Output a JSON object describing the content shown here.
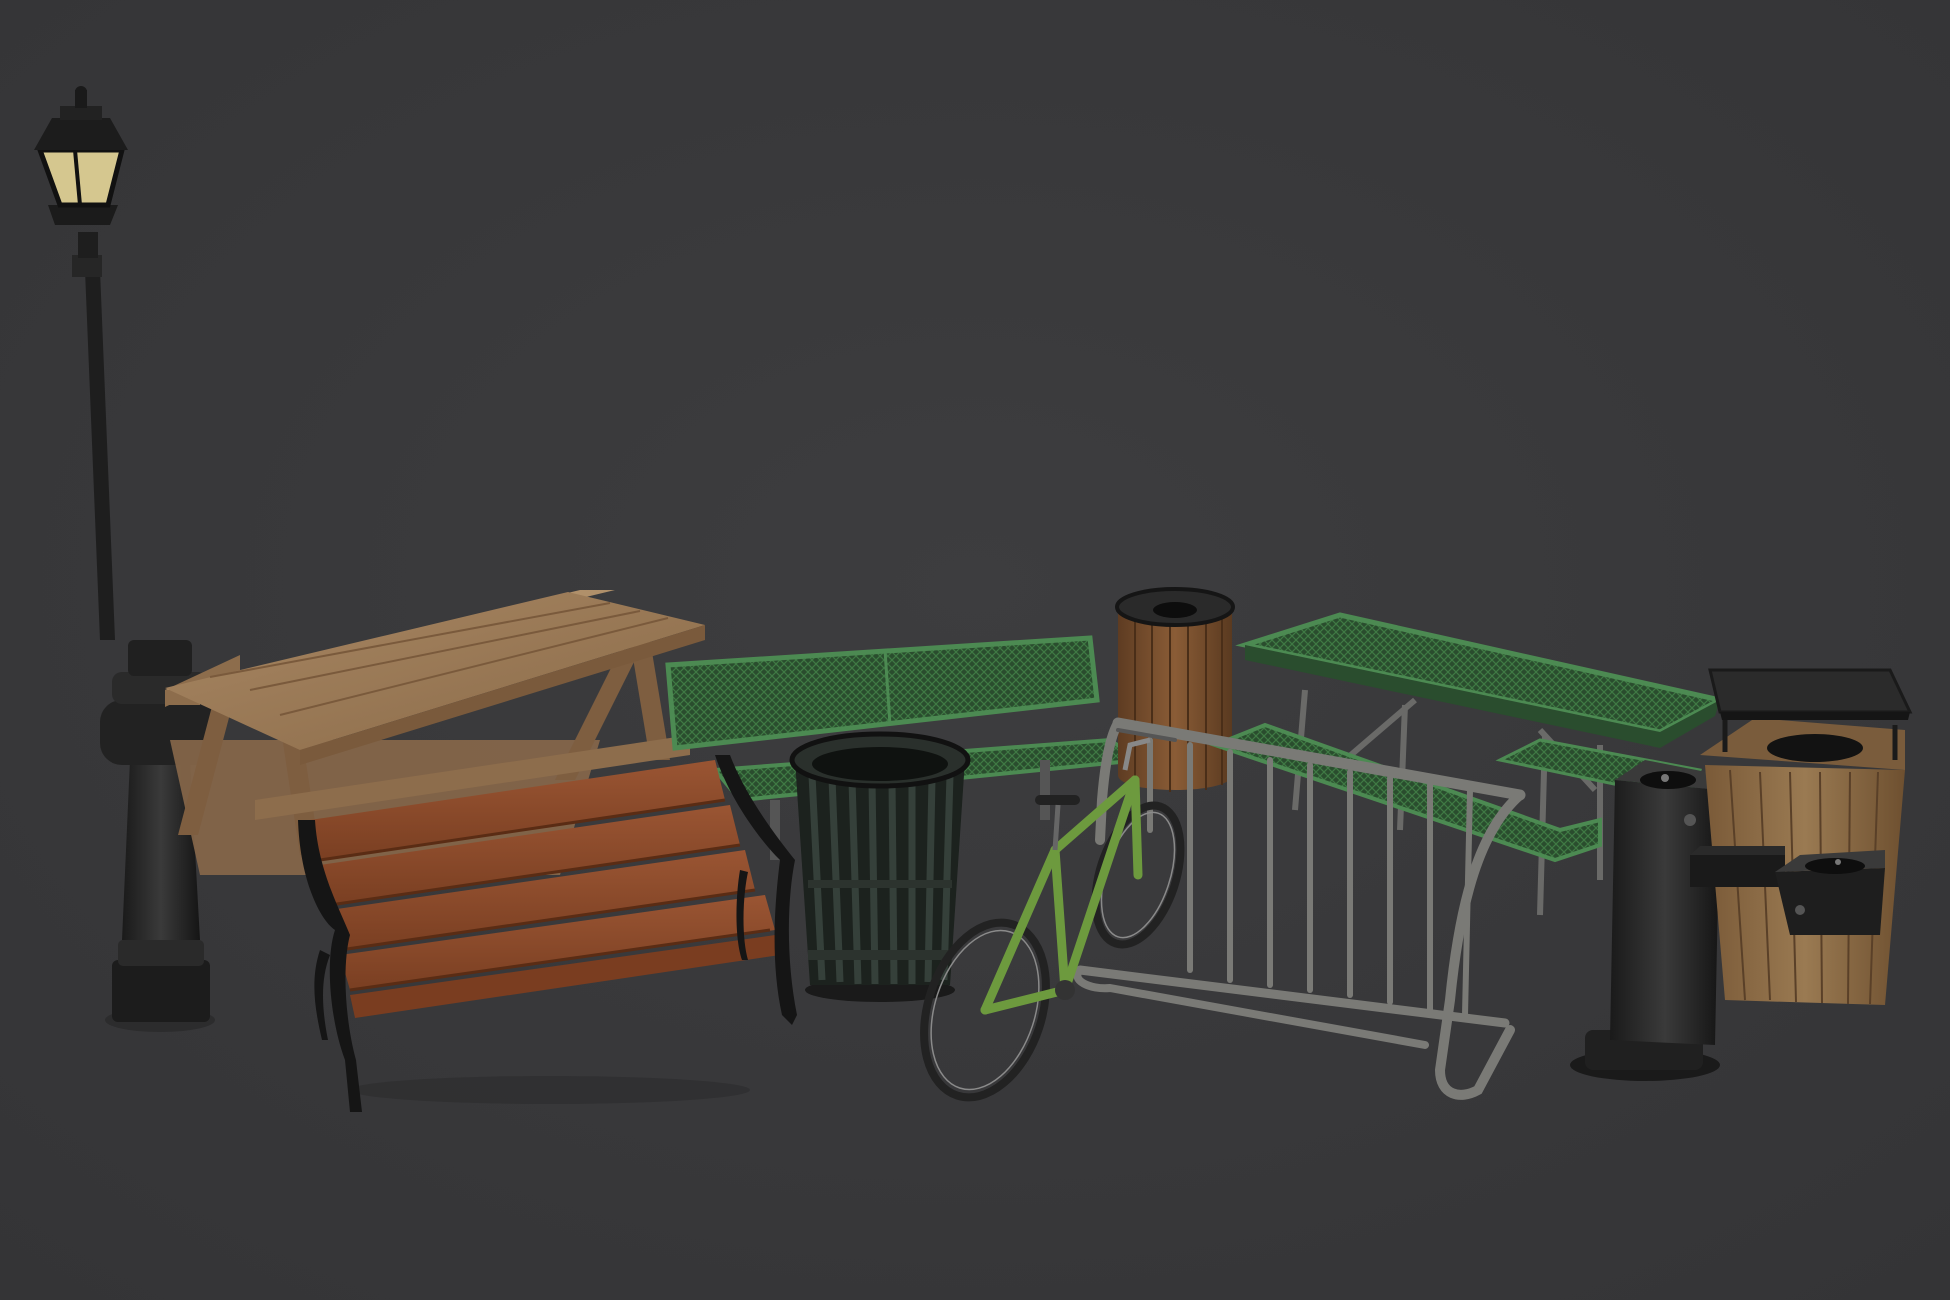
{
  "scene": {
    "background": "#3a3a3c",
    "objects": [
      {
        "id": "street-lamp",
        "material": "black-metal",
        "glass": "#d8c990"
      },
      {
        "id": "wooden-picnic-table",
        "material": "light-wood",
        "color": "#9b7a55"
      },
      {
        "id": "wooden-park-bench",
        "material": "red-wood-cast-iron",
        "color": "#8a4a2a"
      },
      {
        "id": "green-mesh-bench",
        "material": "green-coated-metal",
        "color": "#2f5a34"
      },
      {
        "id": "black-slatted-trash-can",
        "material": "black-metal",
        "color": "#1f2420"
      },
      {
        "id": "wooden-round-trash-can",
        "material": "wood-slats",
        "color": "#7a5232"
      },
      {
        "id": "green-bicycle",
        "material": "green-frame",
        "color": "#5a8a35"
      },
      {
        "id": "bike-rack",
        "material": "steel-tube",
        "color": "#6a6a68"
      },
      {
        "id": "green-mesh-picnic-table",
        "material": "green-coated-metal",
        "color": "#2f5a34"
      },
      {
        "id": "drinking-fountain-pedestal",
        "material": "black-metal",
        "color": "#1c1c1c"
      },
      {
        "id": "wooden-trash-receptacle-with-lid",
        "material": "wood-slats",
        "color": "#8a6a45"
      },
      {
        "id": "wall-drinking-fountain",
        "material": "black-metal",
        "color": "#1c1c1c"
      }
    ]
  }
}
